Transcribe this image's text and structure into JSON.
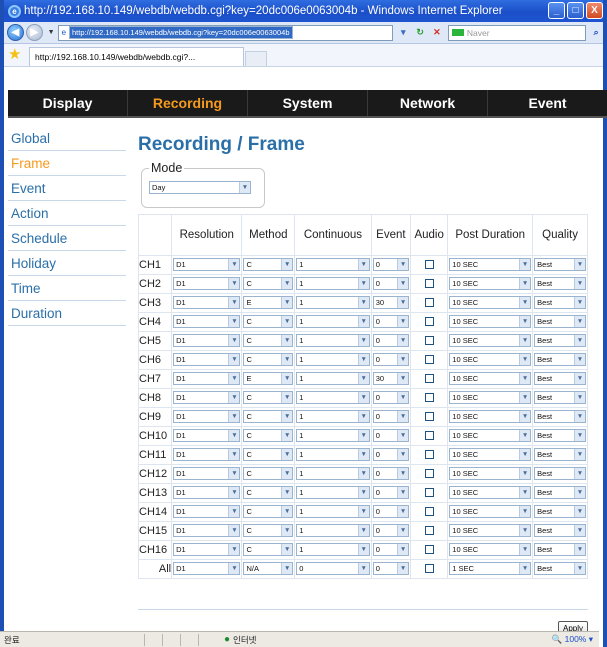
{
  "window": {
    "title": "http://192.168.10.149/webdb/webdb.cgi?key=20dc006e0063004b - Windows Internet Explorer",
    "controls": [
      "_",
      "□",
      "X"
    ]
  },
  "addressbar": {
    "url": "http://192.168.10.149/webdb/webdb.cgi?key=20dc006e0063004b",
    "search_placeholder": "Naver"
  },
  "tab": {
    "label": "http://192.168.10.149/webdb/webdb.cgi?..."
  },
  "topnav": {
    "items": [
      "Display",
      "Recording",
      "System",
      "Network",
      "Event"
    ],
    "active": "Recording"
  },
  "sidebar": {
    "items": [
      "Global",
      "Frame",
      "Event",
      "Action",
      "Schedule",
      "Holiday",
      "Time",
      "Duration"
    ],
    "active": "Frame"
  },
  "page": {
    "title": "Recording / Frame",
    "mode_label": "Mode",
    "mode_value": "Day"
  },
  "table": {
    "headers": {
      "resolution": "Resolution",
      "method": "Method",
      "continuous": "Continuous",
      "event": "Event",
      "audio": "Audio",
      "post_duration": "Post Duration",
      "quality": "Quality"
    },
    "rows": [
      {
        "ch": "CH1",
        "res": "D1",
        "method": "C",
        "cont": "1",
        "event": "0",
        "post": "10 SEC",
        "quality": "Best"
      },
      {
        "ch": "CH2",
        "res": "D1",
        "method": "C",
        "cont": "1",
        "event": "0",
        "post": "10 SEC",
        "quality": "Best"
      },
      {
        "ch": "CH3",
        "res": "D1",
        "method": "E",
        "cont": "1",
        "event": "30",
        "post": "10 SEC",
        "quality": "Best"
      },
      {
        "ch": "CH4",
        "res": "D1",
        "method": "C",
        "cont": "1",
        "event": "0",
        "post": "10 SEC",
        "quality": "Best"
      },
      {
        "ch": "CH5",
        "res": "D1",
        "method": "C",
        "cont": "1",
        "event": "0",
        "post": "10 SEC",
        "quality": "Best"
      },
      {
        "ch": "CH6",
        "res": "D1",
        "method": "C",
        "cont": "1",
        "event": "0",
        "post": "10 SEC",
        "quality": "Best"
      },
      {
        "ch": "CH7",
        "res": "D1",
        "method": "E",
        "cont": "1",
        "event": "30",
        "post": "10 SEC",
        "quality": "Best"
      },
      {
        "ch": "CH8",
        "res": "D1",
        "method": "C",
        "cont": "1",
        "event": "0",
        "post": "10 SEC",
        "quality": "Best"
      },
      {
        "ch": "CH9",
        "res": "D1",
        "method": "C",
        "cont": "1",
        "event": "0",
        "post": "10 SEC",
        "quality": "Best"
      },
      {
        "ch": "CH10",
        "res": "D1",
        "method": "C",
        "cont": "1",
        "event": "0",
        "post": "10 SEC",
        "quality": "Best"
      },
      {
        "ch": "CH11",
        "res": "D1",
        "method": "C",
        "cont": "1",
        "event": "0",
        "post": "10 SEC",
        "quality": "Best"
      },
      {
        "ch": "CH12",
        "res": "D1",
        "method": "C",
        "cont": "1",
        "event": "0",
        "post": "10 SEC",
        "quality": "Best"
      },
      {
        "ch": "CH13",
        "res": "D1",
        "method": "C",
        "cont": "1",
        "event": "0",
        "post": "10 SEC",
        "quality": "Best"
      },
      {
        "ch": "CH14",
        "res": "D1",
        "method": "C",
        "cont": "1",
        "event": "0",
        "post": "10 SEC",
        "quality": "Best"
      },
      {
        "ch": "CH15",
        "res": "D1",
        "method": "C",
        "cont": "1",
        "event": "0",
        "post": "10 SEC",
        "quality": "Best"
      },
      {
        "ch": "CH16",
        "res": "D1",
        "method": "C",
        "cont": "1",
        "event": "0",
        "post": "10 SEC",
        "quality": "Best"
      }
    ],
    "all_row": {
      "ch": "All",
      "res": "D1",
      "method": "N/A",
      "cont": "0",
      "event": "0",
      "post": "1 SEC",
      "quality": "Best"
    }
  },
  "buttons": {
    "apply": "Apply"
  },
  "statusbar": {
    "left": "완료",
    "zone": "인터넷",
    "zoom": "100%"
  },
  "colors": {
    "accent_orange": "#f59a1e",
    "link_blue": "#2a6fa8",
    "nav_bg": "#1a1a1a",
    "ie_blue": "#1e4fb4"
  }
}
